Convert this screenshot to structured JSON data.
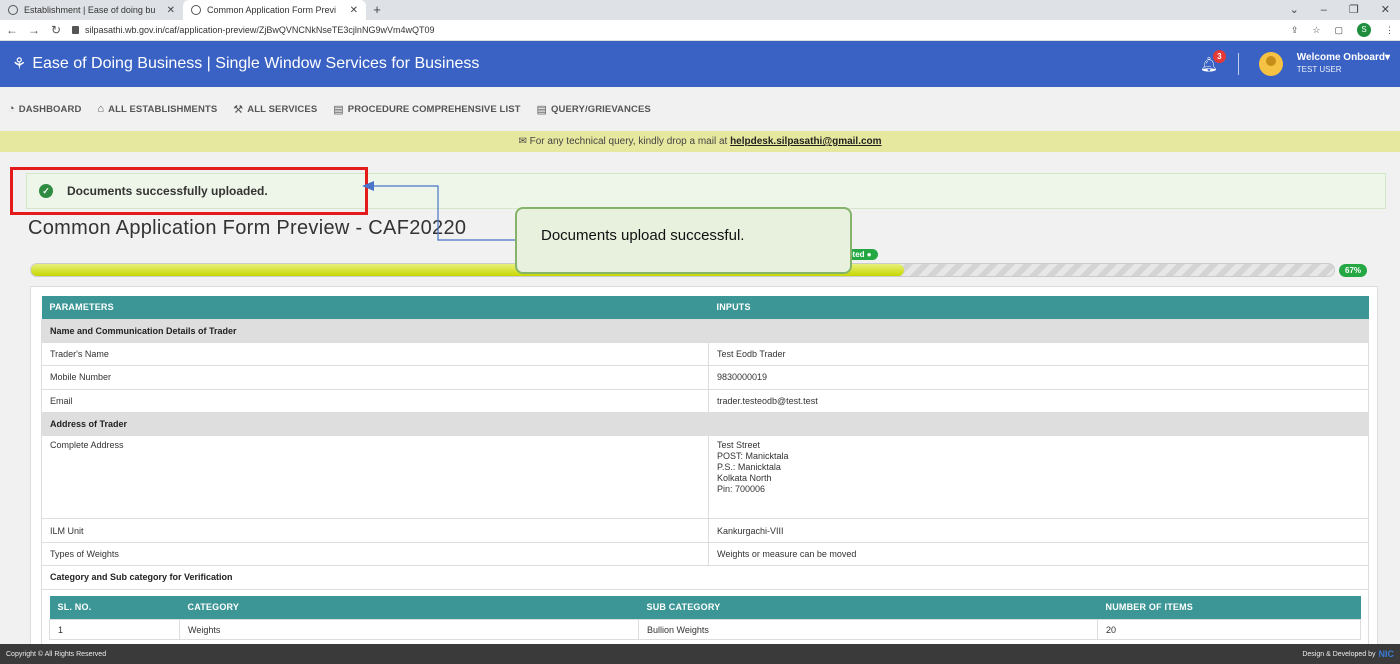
{
  "browser": {
    "tabs": [
      {
        "title": "Establishment | Ease of doing bu"
      },
      {
        "title": "Common Application Form Previ"
      }
    ],
    "new_tab": "+",
    "url": "silpasathi.wb.gov.in/caf/application-preview/ZjBwQVNCNkNseTE3cjlnNG9wVm4wQT09",
    "profile_initial": "S"
  },
  "header": {
    "title": "Ease of Doing Business | Single Window Services for Business",
    "notification_count": "3",
    "welcome": "Welcome Onboard",
    "user": "TEST USER"
  },
  "nav": {
    "items": [
      "DASHBOARD",
      "ALL ESTABLISHMENTS",
      "ALL SERVICES",
      "PROCEDURE COMPREHENSIVE LIST",
      "QUERY/GRIEVANCES"
    ]
  },
  "banner": {
    "text": "For any technical query, kindly drop a mail at ",
    "email": "helpdesk.silpasathi@gmail.com"
  },
  "alert": {
    "message": "Documents successfully uploaded."
  },
  "page": {
    "title": "Common Application Form Preview - CAF20220"
  },
  "progress": {
    "percent_label": "67%",
    "fraction": 0.67,
    "tag": "pleted"
  },
  "callout": {
    "text": "Documents upload successful."
  },
  "table": {
    "headers": [
      "PARAMETERS",
      "INPUTS"
    ],
    "section1": "Name and Communication Details of Trader",
    "rows1": [
      {
        "param": "Trader's Name",
        "value": "Test Eodb Trader"
      },
      {
        "param": "Mobile Number",
        "value": "9830000019"
      },
      {
        "param": "Email",
        "value": "trader.testeodb@test.test"
      }
    ],
    "section2": "Address of Trader",
    "address_label": "Complete Address",
    "address_lines": [
      "Test Street",
      "POST: Manicktala",
      "P.S.: Manicktala",
      "Kolkata North",
      "Pin: 700006"
    ],
    "rows2": [
      {
        "param": "ILM Unit",
        "value": "Kankurgachi-VIII"
      },
      {
        "param": "Types of Weights",
        "value": "Weights or measure can be moved"
      }
    ],
    "section3": "Category and Sub category for Verification",
    "sub_headers": [
      "SL. NO.",
      "CATEGORY",
      "SUB CATEGORY",
      "NUMBER OF ITEMS"
    ],
    "sub_rows": [
      [
        "1",
        "Weights",
        "Bullion Weights",
        "20"
      ]
    ]
  },
  "footer": {
    "copyright": "Copyright © All Rights Reserved",
    "dev": "Design & Developed by",
    "dev_logo": "NIC"
  }
}
